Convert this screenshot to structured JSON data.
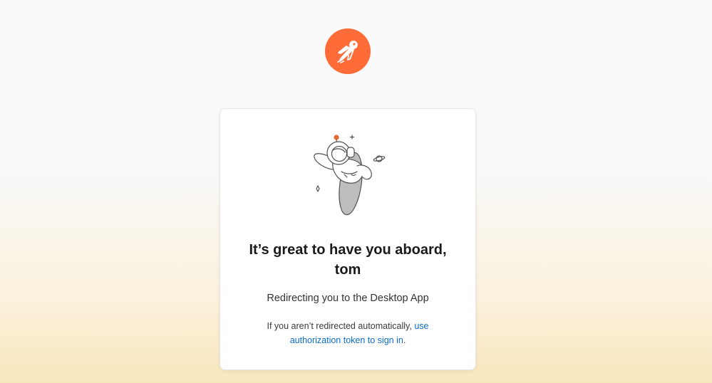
{
  "brand": {
    "logo_icon": "postman-rocket-icon",
    "color": "#ff6c37"
  },
  "illustration": {
    "icon": "astronaut-illustration"
  },
  "card": {
    "title": "It’s great to have you aboard, tom",
    "subtitle": "Redirecting you to the Desktop App",
    "hint_prefix": "If you aren’t redirected automatically, ",
    "hint_link": "use authorization token to sign in",
    "hint_suffix": "."
  },
  "colors": {
    "link": "#0b6ecf",
    "card_background": "#ffffff"
  }
}
